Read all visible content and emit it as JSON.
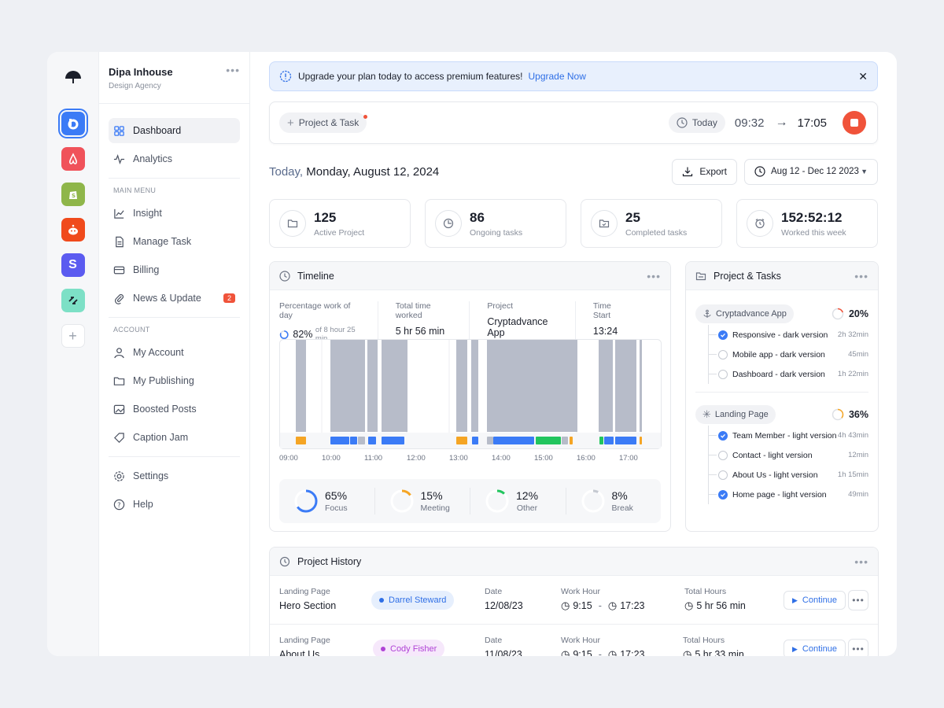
{
  "workspace": {
    "name": "Dipa Inhouse",
    "subtitle": "Design Agency"
  },
  "rail": {
    "apps": [
      {
        "name": "b",
        "color": "#3b7bf6"
      },
      {
        "name": "airbnb",
        "color": "#f0525a"
      },
      {
        "name": "shopify",
        "color": "#8fb64a"
      },
      {
        "name": "reddit",
        "color": "#f04a1c"
      },
      {
        "name": "S",
        "color": "#5b5bf0"
      },
      {
        "name": "link",
        "color": "#7de0c6"
      }
    ]
  },
  "sidebar": {
    "top": [
      {
        "label": "Dashboard",
        "icon": "grid-icon"
      },
      {
        "label": "Analytics",
        "icon": "pulse-icon"
      }
    ],
    "main_menu_title": "MAIN MENU",
    "main": [
      {
        "label": "Insight"
      },
      {
        "label": "Manage Task"
      },
      {
        "label": "Billing"
      },
      {
        "label": "News & Update",
        "badge": "2"
      }
    ],
    "account_title": "ACCOUNT",
    "account": [
      {
        "label": "My Account"
      },
      {
        "label": "My Publishing"
      },
      {
        "label": "Boosted Posts"
      },
      {
        "label": "Caption Jam"
      }
    ],
    "bottom": [
      {
        "label": "Settings"
      },
      {
        "label": "Help"
      }
    ]
  },
  "banner": {
    "text": "Upgrade your plan today to access premium features!",
    "link": "Upgrade Now"
  },
  "tracker": {
    "add_label": "Project & Task",
    "today_label": "Today",
    "start": "09:32",
    "end": "17:05"
  },
  "date": {
    "prefix": "Today,",
    "text": "Monday, August 12, 2024"
  },
  "actions": {
    "export": "Export",
    "range": "Aug 12 - Dec 12 2023"
  },
  "stats": [
    {
      "value": "125",
      "label": "Active Project"
    },
    {
      "value": "86",
      "label": "Ongoing tasks"
    },
    {
      "value": "25",
      "label": "Completed tasks"
    },
    {
      "value": "152:52:12",
      "label": "Worked this week"
    }
  ],
  "timeline": {
    "title": "Timeline",
    "info": [
      {
        "label": "Percentage work of day",
        "value": "82%",
        "extra": "of 8 hour 25 min"
      },
      {
        "label": "Total time worked",
        "value": "5 hr 56 min"
      },
      {
        "label": "Project",
        "value": "Cryptadvance App"
      },
      {
        "label": "Time Start",
        "value": "13:24"
      }
    ],
    "ticks": [
      "09:00",
      "10:00",
      "11:00",
      "12:00",
      "13:00",
      "14:00",
      "15:00",
      "16:00",
      "17:00"
    ],
    "summary": [
      {
        "value": "65%",
        "label": "Focus",
        "color": "#3b7bf6",
        "pct": 0.65
      },
      {
        "value": "15%",
        "label": "Meeting",
        "color": "#f5a524",
        "pct": 0.15
      },
      {
        "value": "12%",
        "label": "Other",
        "color": "#22c55e",
        "pct": 0.12
      },
      {
        "value": "8%",
        "label": "Break",
        "color": "#c5c9d1",
        "pct": 0.08
      }
    ]
  },
  "project_tasks": {
    "title": "Project & Tasks",
    "groups": [
      {
        "name": "Cryptadvance App",
        "pct": "20%",
        "color": "#f0533a",
        "fraction": 0.2,
        "items": [
          {
            "label": "Responsive - dark version",
            "dur": "2h 32min",
            "done": true
          },
          {
            "label": "Mobile app - dark version",
            "dur": "45min",
            "done": false
          },
          {
            "label": "Dashboard - dark version",
            "dur": "1h 22min",
            "done": false
          }
        ]
      },
      {
        "name": "Landing Page",
        "pct": "36%",
        "color": "#f5a524",
        "fraction": 0.36,
        "items": [
          {
            "label": "Team Member - light version",
            "dur": "4h 43min",
            "done": true
          },
          {
            "label": "Contact - light version",
            "dur": "12min",
            "done": false
          },
          {
            "label": "About Us - light version",
            "dur": "1h 15min",
            "done": false
          },
          {
            "label": "Home page - light version",
            "dur": "49min",
            "done": true
          }
        ]
      }
    ]
  },
  "history": {
    "title": "Project History",
    "rows": [
      {
        "project": "Landing Page",
        "task": "Hero Section",
        "person": "Darrel Steward",
        "person_bg": "#e6effd",
        "person_color": "#2f6fe6",
        "date_label": "Date",
        "date": "12/08/23",
        "work_label": "Work Hour",
        "from": "9:15",
        "to": "17:23",
        "total_label": "Total Hours",
        "total": "5 hr 56 min",
        "action": "Continue"
      },
      {
        "project": "Landing Page",
        "task": "About Us",
        "person": "Cody Fisher",
        "person_bg": "#f6e8fb",
        "person_color": "#b043d6",
        "date_label": "Date",
        "date": "11/08/23",
        "work_label": "Work Hour",
        "from": "9:15",
        "to": "17:23",
        "total_label": "Total Hours",
        "total": "5 hr 33 min",
        "action": "Continue"
      }
    ]
  }
}
